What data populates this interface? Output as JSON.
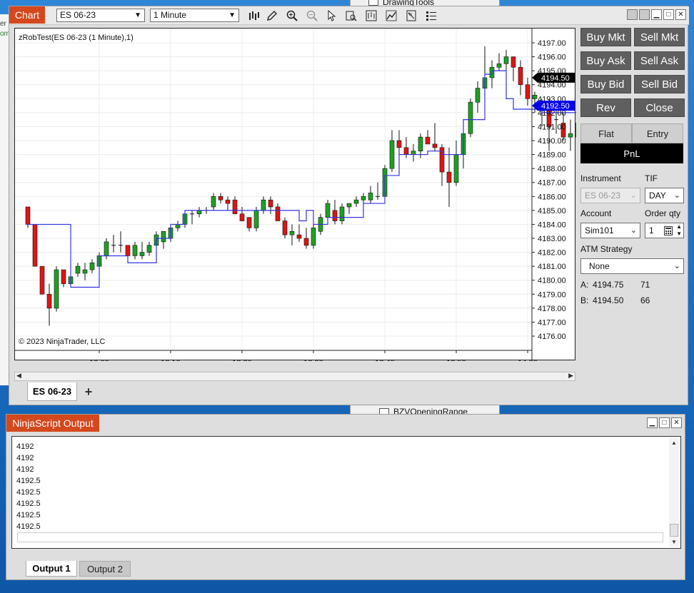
{
  "window": {
    "title": "Chart",
    "instrument_select": "ES 06-23",
    "interval_select": "1 Minute"
  },
  "background_window": {
    "items": [
      "DrawingTools",
      "BZVOpeningRange"
    ]
  },
  "background_left": {
    "fragments": [
      "er",
      "om"
    ]
  },
  "chart": {
    "indicator_label": "zRobTest(ES 06-23 (1 Minute),1)",
    "copyright": "© 2023 NinjaTrader, LLC",
    "price_ticks": [
      "4197.00",
      "4196.00",
      "4195.00",
      "4194.00",
      "4193.00",
      "4192.00",
      "4191.00",
      "4190.00",
      "4189.00",
      "4188.00",
      "4187.00",
      "4186.00",
      "4185.00",
      "4184.00",
      "4183.00",
      "4182.00",
      "4181.00",
      "4180.00",
      "4179.00",
      "4178.00",
      "4177.00",
      "4176.00"
    ],
    "time_ticks": [
      "13:00",
      "13:10",
      "13:20",
      "13:30",
      "13:40",
      "13:50",
      "14:00"
    ],
    "last_price_marker": "4194.50",
    "indicator_marker": "4192.50",
    "colors": {
      "up": "#1fa024",
      "down": "#e01414",
      "indicator": "#3333dd",
      "last_price_bg": "#000000",
      "indicator_bg": "#0000ee"
    }
  },
  "tabs": {
    "active": "ES 06-23",
    "add_label": "+"
  },
  "trader": {
    "buy_mkt": "Buy Mkt",
    "sell_mkt": "Sell Mkt",
    "buy_ask": "Buy Ask",
    "sell_ask": "Sell Ask",
    "buy_bid": "Buy Bid",
    "sell_bid": "Sell Bid",
    "rev": "Rev",
    "close": "Close",
    "flat": "Flat",
    "entry": "Entry",
    "pnl": "PnL",
    "instrument_label": "Instrument",
    "instrument_value": "ES 06-23",
    "tif_label": "TIF",
    "tif_value": "DAY",
    "account_label": "Account",
    "account_value": "Sim101",
    "order_qty_label": "Order qty",
    "order_qty_value": "1",
    "atm_label": "ATM Strategy",
    "atm_value": "None",
    "ask_label": "A:",
    "ask_price": "4194.75",
    "ask_size": "71",
    "bid_label": "B:",
    "bid_price": "4194.50",
    "bid_size": "66"
  },
  "output": {
    "title": "NinjaScript Output",
    "lines": [
      "4192",
      "4192",
      "4192",
      "4192.5",
      "4192.5",
      "4192.5",
      "4192.5",
      "4192.5"
    ],
    "tab1": "Output 1",
    "tab2": "Output 2"
  }
}
